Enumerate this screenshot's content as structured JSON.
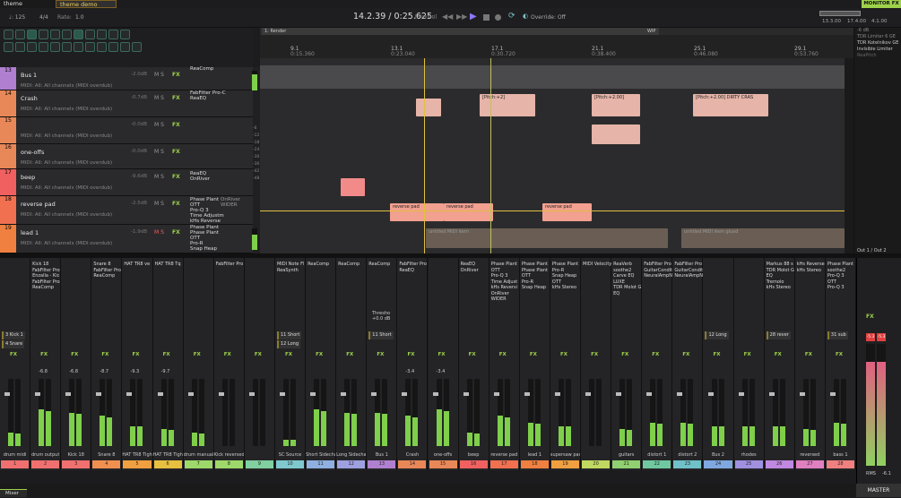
{
  "tabs": {
    "tab1": "theme tester.rpp",
    "tab2": "theme demo 2.rpp"
  },
  "header": {
    "bpm": "♩: 125",
    "timesig": "4/4",
    "rate_label": "Rate:",
    "rate": "1.0",
    "time": "14.2.39 / 0:25.625",
    "play_state": "[Playing]",
    "override": "Override: Off",
    "ruler_right": [
      "13.3.00",
      "17.4.00",
      "4.1.00"
    ],
    "monitor_fx": "MONITOR FX"
  },
  "monitor_fx_list": [
    "-6 dB",
    "TDR Limiter 6 GE",
    "TDR Kotelnikov GE",
    "Invisible Limiter",
    "ReaPitch"
  ],
  "regions": {
    "region1": "1: Render",
    "marker": "WIP"
  },
  "timeline": {
    "bars": [
      "9.1",
      "13.1",
      "17.1",
      "21.1",
      "25.1",
      "29.1"
    ],
    "times": [
      "0:15.360",
      "0:23.040",
      "0:30.720",
      "0:38.400",
      "0:46.080",
      "0:53.760"
    ]
  },
  "tracks": [
    {
      "num": "13",
      "name": "Bus 1",
      "midi": "MIDI: All: All channels (MIDI overdub)",
      "vol": "-2.0dB",
      "fx": [
        "ReaComp"
      ],
      "color": "#b07fd0"
    },
    {
      "num": "14",
      "name": "Crash",
      "midi": "MIDI: All: All channels (MIDI overdub)",
      "vol": "-0.7dB",
      "pan": "center",
      "fx": [
        "FabFilter Pro-C",
        "ReaEQ"
      ],
      "color": "#e88858"
    },
    {
      "num": "15",
      "name": "",
      "midi": "MIDI: All: All channels (MIDI overdub)",
      "vol": "-0.0dB",
      "pan": "center",
      "fx": [],
      "color": "#e88858"
    },
    {
      "num": "16",
      "name": "one-offs",
      "midi": "MIDI: All: All channels (MIDI overdub)",
      "vol": "-0.0dB",
      "pan": "center",
      "fx": [],
      "color": "#e88858"
    },
    {
      "num": "17",
      "name": "beep",
      "midi": "MIDI: All: All channels (MIDI overdub)",
      "vol": "-9.6dB",
      "pan": "center",
      "fx": [
        "ReaEQ",
        "OnRiver"
      ],
      "color": "#f06060"
    },
    {
      "num": "18",
      "name": "reverse pad",
      "midi": "MIDI: All: All channels (MIDI overdub)",
      "vol": "-2.5dB",
      "pan": "center",
      "fx": [
        "Phase Plant",
        "OTT",
        "Pro-Q 3",
        "Time Adjustm",
        "kHs Reverse"
      ],
      "fx2": [
        "OnRiver",
        "WIDER"
      ],
      "color": "#f07050"
    },
    {
      "num": "19",
      "name": "lead 1",
      "midi": "MIDI: All: All channels (MIDI overdub)",
      "vol": "-1.9dB",
      "pan": "center",
      "fx": [
        "Phase Plant",
        "Phase Plant",
        "OTT",
        "Pro-R",
        "Snap Heap"
      ],
      "color": "#f08040"
    }
  ],
  "tcp_ms": "M  S",
  "tcp_fx": "FX",
  "clips": {
    "pitch1": "[Pitch:+2]",
    "pitch2": "[Pitch:+2.00]",
    "pitch3": "[Pitch:+2.00] DIRTY CRAS",
    "rev1": "reverse pad",
    "rev2": "reverse pad",
    "rev3": "reverse pad",
    "midi1": "untitled MIDI item",
    "midi2": "untitled MIDI item glued"
  },
  "out_label": "Out 1 / Out 2",
  "db_scale": [
    "-6",
    "-12",
    "-18",
    "-24",
    "-30",
    "-36",
    "-42",
    "-48"
  ],
  "mixer": {
    "strips": [
      {
        "name": "drum midi",
        "num": "1",
        "color": "#f07070",
        "fx": [],
        "send": "3 Kick 1",
        "send2": "4 Snare",
        "lvl": 0.2
      },
      {
        "name": "drum output",
        "num": "2",
        "color": "#f07070",
        "fx": [
          "Kick 18",
          "FabFilter Pro",
          "Enzalla - Kic",
          "FabFilter Pro",
          "ReaComp"
        ],
        "lvl": 0.55,
        "peak": "-6.8"
      },
      {
        "name": "Kick 18",
        "num": "3",
        "color": "#f07070",
        "fx": [],
        "lvl": 0.5,
        "peak": "-6.8"
      },
      {
        "name": "Snare 8",
        "num": "4",
        "color": "#f09050",
        "fx": [
          "Snare 8",
          "FabFilter Pro",
          "ReaComp"
        ],
        "lvl": 0.45,
        "peak": "-8.7"
      },
      {
        "name": "HAT TR8 Tigh",
        "num": "5",
        "color": "#f0a040",
        "fx": [
          "HAT TR8 ve"
        ],
        "lvl": 0.3,
        "peak": "-9.3"
      },
      {
        "name": "HAT TR8 Tigh",
        "num": "6",
        "color": "#e8c040",
        "fx": [
          "HAT TR8 Tq"
        ],
        "lvl": 0.25,
        "peak": "-9.7"
      },
      {
        "name": "drum manual",
        "num": "7",
        "color": "#9ed86a",
        "fx": [],
        "lvl": 0.2
      },
      {
        "name": "Kick reversed",
        "num": "8",
        "color": "#9ed86a",
        "fx": [
          "FabFilter Pro"
        ],
        "lvl": 0.0
      },
      {
        "name": "",
        "num": "9",
        "color": "#80d0a0",
        "fx": [],
        "lvl": 0.0
      },
      {
        "name": "SC Source",
        "num": "10",
        "color": "#80c8d0",
        "fx": [
          "MIDI Note Fl",
          "ReaSynth"
        ],
        "send": "11 Short",
        "send2": "12 Long",
        "lvl": 0.1
      },
      {
        "name": "Short Sidechai",
        "num": "11",
        "color": "#8fb0e0",
        "fx": [
          "ReaComp"
        ],
        "lvl": 0.55
      },
      {
        "name": "Long Sidechai",
        "num": "12",
        "color": "#9fa0e0",
        "fx": [
          "ReaComp"
        ],
        "lvl": 0.5
      },
      {
        "name": "Bus 1",
        "num": "13",
        "color": "#b080d0",
        "fx": [
          "ReaComp"
        ],
        "send": "11 Short",
        "lvl": 0.5
      },
      {
        "name": "Crash",
        "num": "14",
        "color": "#e88858",
        "fx": [
          "FabFilter Pro",
          "ReaEQ"
        ],
        "lvl": 0.45,
        "peak": "-3.4"
      },
      {
        "name": "one-offs",
        "num": "15",
        "color": "#e88858",
        "fx": [],
        "lvl": 0.55,
        "peak": "-3.4"
      },
      {
        "name": "beep",
        "num": "16",
        "color": "#f06060",
        "fx": [
          "ReaEQ",
          "OnRiver"
        ],
        "lvl": 0.2
      },
      {
        "name": "reverse pad",
        "num": "17",
        "color": "#f07050",
        "fx": [
          "Phase Plant",
          "OTT",
          "Pro-Q 3",
          "Time Adjust",
          "kHs Reversi",
          "OnRiver",
          "WIDER"
        ],
        "lvl": 0.45
      },
      {
        "name": "lead 1",
        "num": "18",
        "color": "#f08040",
        "fx": [
          "Phase Plant",
          "Phase Plant",
          "OTT",
          "Pro-R",
          "Snap Heap"
        ],
        "lvl": 0.35
      },
      {
        "name": "supersaw pad",
        "num": "19",
        "color": "#f0a040",
        "fx": [
          "Phase Plant",
          "Pro-R",
          "Snap Heap",
          "OTT",
          "kHs Stereo"
        ],
        "lvl": 0.3
      },
      {
        "name": "",
        "num": "20",
        "color": "#c0d860",
        "fx": [
          "MIDI Velocity"
        ],
        "lvl": 0.0
      },
      {
        "name": "guitars",
        "num": "21",
        "color": "#90d070",
        "fx": [
          "ReaVerb",
          "soothe2",
          "Carve EQ",
          "LUXE",
          "TDR Molot G",
          "EQ"
        ],
        "lvl": 0.25
      },
      {
        "name": "distort 1",
        "num": "22",
        "color": "#70c8a0",
        "fx": [
          "FabFilter Pro",
          "GuitarCondit",
          "NeuralAmpN"
        ],
        "lvl": 0.35
      },
      {
        "name": "distort 2",
        "num": "23",
        "color": "#70c0c8",
        "fx": [
          "FabFilter Pro",
          "GuitarCondit",
          "NeuralAmpN"
        ],
        "lvl": 0.35
      },
      {
        "name": "Bus 2",
        "num": "24",
        "color": "#80a8e0",
        "fx": [],
        "send": "12 Long",
        "lvl": 0.3
      },
      {
        "name": "rhodes",
        "num": "25",
        "color": "#a090e0",
        "fx": [],
        "lvl": 0.3
      },
      {
        "name": "",
        "num": "26",
        "color": "#c088e0",
        "fx": [
          "Markus 88 s",
          "TDR Molot G",
          "EQ",
          "Tremolo",
          "kHs Stereo"
        ],
        "send": "28 rever",
        "lvl": 0.3
      },
      {
        "name": "reversed",
        "num": "27",
        "color": "#e080c0",
        "fx": [
          "kHs Reverse",
          "kHs Stereo"
        ],
        "lvl": 0.25
      },
      {
        "name": "bass 1",
        "num": "28",
        "color": "#f08080",
        "fx": [
          "Phase Plant",
          "soothe2",
          "Pro-Q 3",
          "OTT",
          "Pro-Q 3"
        ],
        "send": "31 sub",
        "lvl": 0.35
      }
    ],
    "master": {
      "name": "MASTER",
      "rms": "RMS",
      "val": "-6.1",
      "peak1": "-5.3",
      "peak2": "-5.3"
    },
    "tab": "Mixer",
    "thresh": "Thresho",
    "thresh_val": "+0.0 dB"
  },
  "colors": {
    "accent": "#9ed24a",
    "play": "#8c78ff",
    "cursor": "#e0c040"
  }
}
